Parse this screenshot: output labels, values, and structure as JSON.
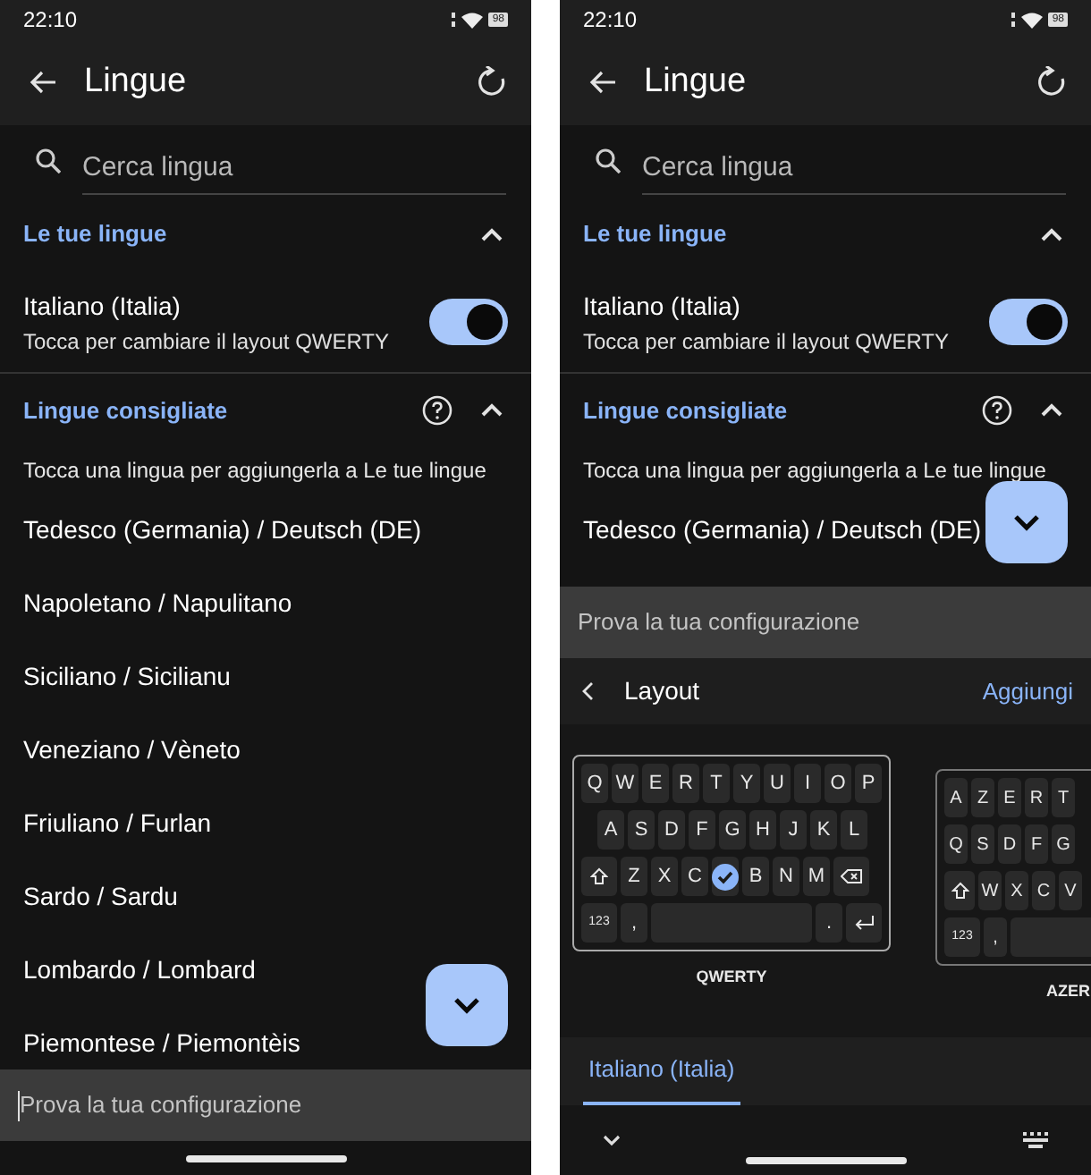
{
  "phones": [
    {
      "status_bar": {
        "time": "22:10",
        "battery": "98"
      },
      "app_bar": {
        "title": "Lingue"
      },
      "search": {
        "placeholder": "Cerca lingua"
      },
      "sections": [
        {
          "title": "Le tue lingue",
          "expanded": true,
          "help": false,
          "items": [
            {
              "kind": "toggle",
              "title": "Italiano (Italia)",
              "subtitle": "Tocca per cambiare il layout QWERTY",
              "on": true
            }
          ]
        },
        {
          "title": "Lingue consigliate",
          "expanded": true,
          "help": true,
          "hint": "Tocca una lingua per aggiungerla a Le tue lingue",
          "items": [
            {
              "kind": "language",
              "title": "Tedesco (Germania) / Deutsch (DE)"
            },
            {
              "kind": "language",
              "title": "Napoletano / Napulitano"
            },
            {
              "kind": "language",
              "title": "Siciliano / Sicilianu"
            },
            {
              "kind": "language",
              "title": "Veneziano / Vèneto"
            },
            {
              "kind": "language",
              "title": "Friuliano / Furlan"
            },
            {
              "kind": "language",
              "title": "Sardo / Sardu"
            },
            {
              "kind": "language",
              "title": "Lombardo / Lombard"
            },
            {
              "kind": "language",
              "title": "Piemontese / Piemontèis"
            }
          ]
        }
      ],
      "test_field": {
        "placeholder": "Prova la tua configurazione",
        "focused": true
      }
    },
    {
      "status_bar": {
        "time": "22:10",
        "battery": "98"
      },
      "app_bar": {
        "title": "Lingue"
      },
      "search": {
        "placeholder": "Cerca lingua"
      },
      "sections": [
        {
          "title": "Le tue lingue",
          "expanded": true,
          "help": false,
          "items": [
            {
              "kind": "toggle",
              "title": "Italiano (Italia)",
              "subtitle": "Tocca per cambiare il layout QWERTY",
              "on": true
            }
          ]
        },
        {
          "title": "Lingue consigliate",
          "expanded": true,
          "help": true,
          "hint": "Tocca una lingua per aggiungerla a Le tue lingue",
          "items": [
            {
              "kind": "language",
              "title": "Tedesco (Germania) / Deutsch (DE)"
            }
          ]
        }
      ],
      "test_field": {
        "placeholder": "Prova la tua configurazione",
        "focused": false
      },
      "keyboard_panel": {
        "title": "Layout",
        "action": "Aggiungi",
        "layouts": [
          {
            "name": "QWERTY",
            "selected": true,
            "rows": [
              [
                "Q",
                "W",
                "E",
                "R",
                "T",
                "Y",
                "U",
                "I",
                "O",
                "P"
              ],
              [
                "A",
                "S",
                "D",
                "F",
                "G",
                "H",
                "J",
                "K",
                "L"
              ],
              [
                {
                  "kind": "shift"
                },
                "Z",
                "X",
                "C",
                {
                  "kind": "blank"
                },
                "B",
                "N",
                "M",
                {
                  "kind": "backspace"
                }
              ],
              [
                {
                  "kind": "mode",
                  "label": "123"
                },
                ",",
                {
                  "kind": "space"
                },
                ".",
                {
                  "kind": "enter"
                }
              ]
            ]
          },
          {
            "name": "AZER",
            "selected": false,
            "rows": [
              [
                "A",
                "Z",
                "E",
                "R",
                "T"
              ],
              [
                "Q",
                "S",
                "D",
                "F",
                "G"
              ],
              [
                {
                  "kind": "shift"
                },
                "W",
                "X",
                "C",
                "V"
              ],
              [
                {
                  "kind": "mode",
                  "label": "123"
                },
                ",",
                {
                  "kind": "space"
                }
              ]
            ]
          }
        ],
        "tabs": [
          {
            "label": "Italiano (Italia)",
            "selected": true
          }
        ]
      }
    }
  ]
}
